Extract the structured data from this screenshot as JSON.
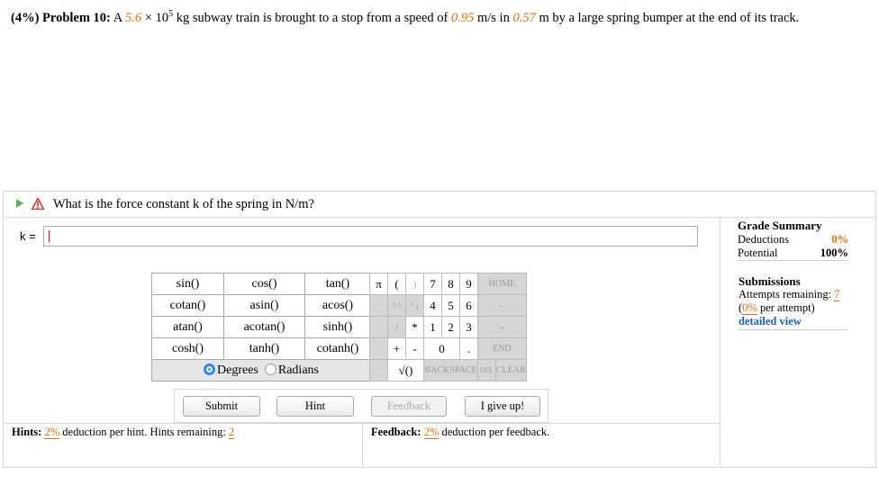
{
  "problem": {
    "weight": "(4%)",
    "label": "Problem 10:",
    "text_a": " A ",
    "mass": "5.6",
    "times": " × 10",
    "exponent": "5",
    "text_b": " kg subway train is brought to a stop from a speed of ",
    "speed": "0.95",
    "text_c": " m/s in ",
    "distance": "0.57",
    "text_d": " m by a large spring bumper at the end of its track."
  },
  "question": {
    "text": "What is the force constant k of the spring in N/m?",
    "var_label": "k =",
    "input_value": ""
  },
  "grade_summary": {
    "title": "Grade Summary",
    "deductions_label": "Deductions",
    "deductions_value": "0%",
    "potential_label": "Potential",
    "potential_value": "100%"
  },
  "submissions": {
    "title": "Submissions",
    "attempts_label": "Attempts remaining: ",
    "attempts_value": "7",
    "per_attempt_open": "(",
    "per_attempt_value": "0%",
    "per_attempt_text": " per attempt)",
    "detail_link": "detailed view"
  },
  "calculator": {
    "functions": [
      [
        "sin()",
        "cos()",
        "tan()"
      ],
      [
        "cotan()",
        "asin()",
        "acos()"
      ],
      [
        "atan()",
        "acotan()",
        "sinh()"
      ],
      [
        "cosh()",
        "tanh()",
        "cotanh()"
      ]
    ],
    "degrees": "Degrees",
    "radians": "Radians",
    "keys": {
      "pi": "π",
      "lparen": "(",
      "rparen": ")",
      "k7": "7",
      "k8": "8",
      "k9": "9",
      "home": "HOME",
      "uparr": "↑^",
      "updn": "^↓",
      "k4": "4",
      "k5": "5",
      "k6": "6",
      "left": "←",
      "slash": "/",
      "star": "*",
      "k1": "1",
      "k2": "2",
      "k3": "3",
      "right": "→",
      "plus": "+",
      "minus": "-",
      "k0": "0",
      "dot": ".",
      "end": "END",
      "sqrt": "√()",
      "backspace": "BACKSPACE",
      "del": "DEL",
      "clear": "CLEAR"
    }
  },
  "buttons": {
    "submit": "Submit",
    "hint": "Hint",
    "feedback": "Feedback",
    "give_up": "I give up!"
  },
  "hints": {
    "label": "Hints:",
    "pct": "2%",
    "text": " deduction per hint. Hints remaining: ",
    "remaining": "2"
  },
  "feedback": {
    "label": "Feedback:",
    "pct": "2%",
    "text": " deduction per feedback."
  },
  "colors": {
    "accent": "#e36c0a",
    "link": "#1a5fb4",
    "play": "#5ab552",
    "warn": "#d32f2f"
  }
}
